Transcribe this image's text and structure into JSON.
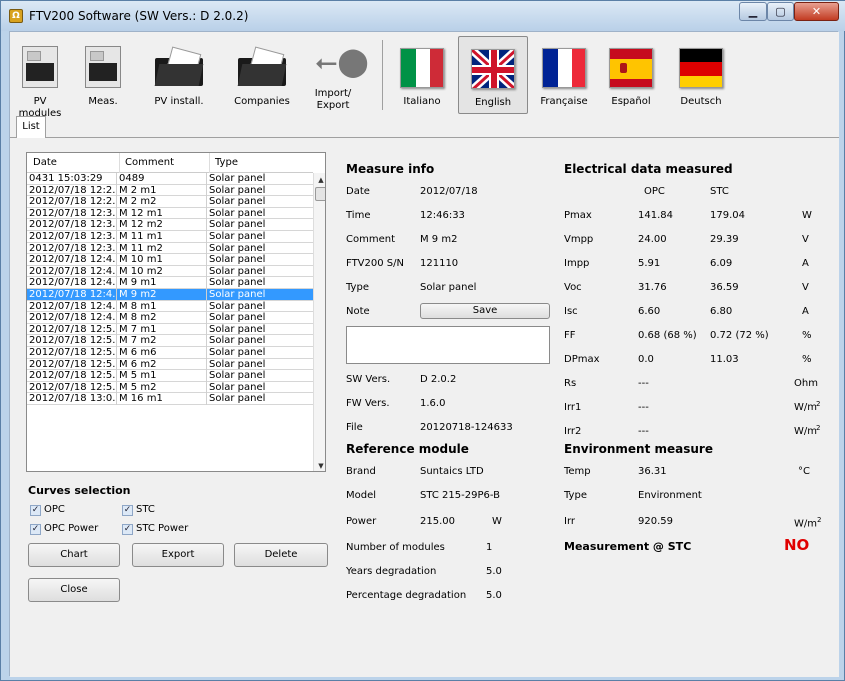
{
  "window": {
    "title": "FTV200 Software (SW Vers.: D 2.0.2)",
    "app_icon": "app-logo-icon"
  },
  "toolbar": {
    "pv_modules": "PV modules",
    "meas": "Meas.",
    "pv_install": "PV install.",
    "companies": "Companies",
    "import_export_1": "Import/",
    "import_export_2": "Export",
    "italiano": "Italiano",
    "english": "English",
    "francaise": "Française",
    "espanol": "Español",
    "deutsch": "Deutsch"
  },
  "tabs": {
    "list": "List"
  },
  "grid": {
    "headers": [
      "Date",
      "Comment",
      "Type"
    ],
    "rows": [
      [
        "0431 15:03:29",
        "0489",
        "Solar panel"
      ],
      [
        "2012/07/18 12:2...",
        "M 2 m1",
        "Solar panel"
      ],
      [
        "2012/07/18 12:2...",
        "M 2 m2",
        "Solar panel"
      ],
      [
        "2012/07/18 12:3...",
        "M 12 m1",
        "Solar panel"
      ],
      [
        "2012/07/18 12:3...",
        "M 12 m2",
        "Solar panel"
      ],
      [
        "2012/07/18 12:3...",
        "M 11 m1",
        "Solar panel"
      ],
      [
        "2012/07/18 12:3...",
        "M 11 m2",
        "Solar panel"
      ],
      [
        "2012/07/18 12:4...",
        "M 10 m1",
        "Solar panel"
      ],
      [
        "2012/07/18 12:4...",
        "M 10 m2",
        "Solar panel"
      ],
      [
        "2012/07/18 12:4...",
        "M 9 m1",
        "Solar panel"
      ],
      [
        "2012/07/18 12:4...",
        "M 9 m2",
        "Solar panel"
      ],
      [
        "2012/07/18 12:4...",
        "M 8 m1",
        "Solar panel"
      ],
      [
        "2012/07/18 12:4...",
        "M 8 m2",
        "Solar panel"
      ],
      [
        "2012/07/18 12:5...",
        "M 7 m1",
        "Solar panel"
      ],
      [
        "2012/07/18 12:5...",
        "M 7 m2",
        "Solar panel"
      ],
      [
        "2012/07/18 12:5...",
        "M 6 m6",
        "Solar panel"
      ],
      [
        "2012/07/18 12:5...",
        "M 6 m2",
        "Solar panel"
      ],
      [
        "2012/07/18 12:5...",
        "M 5 m1",
        "Solar panel"
      ],
      [
        "2012/07/18 12:5...",
        "M 5 m2",
        "Solar panel"
      ],
      [
        "2012/07/18 13:0...",
        "M 16 m1",
        "Solar panel"
      ]
    ],
    "selected_index": 10
  },
  "curves": {
    "title": "Curves selection",
    "opc": "OPC",
    "stc": "STC",
    "opc_power": "OPC Power",
    "stc_power": "STC Power",
    "check_mark": "✓"
  },
  "buttons": {
    "chart": "Chart",
    "export": "Export",
    "delete": "Delete",
    "close": "Close",
    "save": "Save"
  },
  "measure_info": {
    "title": "Measure info",
    "date_l": "Date",
    "date_v": "2012/07/18",
    "time_l": "Time",
    "time_v": "12:46:33",
    "comment_l": "Comment",
    "comment_v": "M 9 m2",
    "sn_l": "FTV200 S/N",
    "sn_v": "121110",
    "type_l": "Type",
    "type_v": "Solar panel",
    "note_l": "Note",
    "sw_l": "SW Vers.",
    "sw_v": "D 2.0.2",
    "fw_l": "FW Vers.",
    "fw_v": "1.6.0",
    "file_l": "File",
    "file_v": "20120718-124633"
  },
  "reference": {
    "title": "Reference module",
    "brand_l": "Brand",
    "brand_v": "Suntaics LTD",
    "model_l": "Model",
    "model_v": "STC 215-29P6-B",
    "power_l": "Power",
    "power_v": "215.00",
    "power_u": "W",
    "nmod_l": "Number of modules",
    "nmod_v": "1",
    "years_l": "Years degradation",
    "years_v": "5.0",
    "perc_l": "Percentage degradation",
    "perc_v": "5.0"
  },
  "electrical": {
    "title": "Electrical data measured",
    "col_opc": "OPC",
    "col_stc": "STC",
    "rows": [
      {
        "l": "Pmax",
        "opc": "141.84",
        "stc": "179.04",
        "u": "W"
      },
      {
        "l": "Vmpp",
        "opc": "24.00",
        "stc": "29.39",
        "u": "V"
      },
      {
        "l": "Impp",
        "opc": "5.91",
        "stc": "6.09",
        "u": "A"
      },
      {
        "l": "Voc",
        "opc": "31.76",
        "stc": "36.59",
        "u": "V"
      },
      {
        "l": "Isc",
        "opc": "6.60",
        "stc": "6.80",
        "u": "A"
      },
      {
        "l": "FF",
        "opc": "0.68 (68 %)",
        "stc": "0.72 (72 %)",
        "u": "%"
      },
      {
        "l": "DPmax",
        "opc": "0.0",
        "stc": "11.03",
        "u": "%"
      },
      {
        "l": "Rs",
        "opc": "---",
        "stc": "",
        "u": "Ohm"
      },
      {
        "l": "Irr1",
        "opc": "---",
        "stc": "",
        "u": "W/m"
      },
      {
        "l": "Irr2",
        "opc": "---",
        "stc": "",
        "u": "W/m"
      }
    ],
    "sup2": "2"
  },
  "environment": {
    "title": "Environment measure",
    "temp_l": "Temp",
    "temp_v": "36.31",
    "temp_u": "°C",
    "type_l": "Type",
    "type_v": "Environment",
    "irr_l": "Irr",
    "irr_v": "920.59",
    "irr_u": "W/m",
    "stc_l": "Measurement @ STC",
    "stc_v": "NO"
  }
}
